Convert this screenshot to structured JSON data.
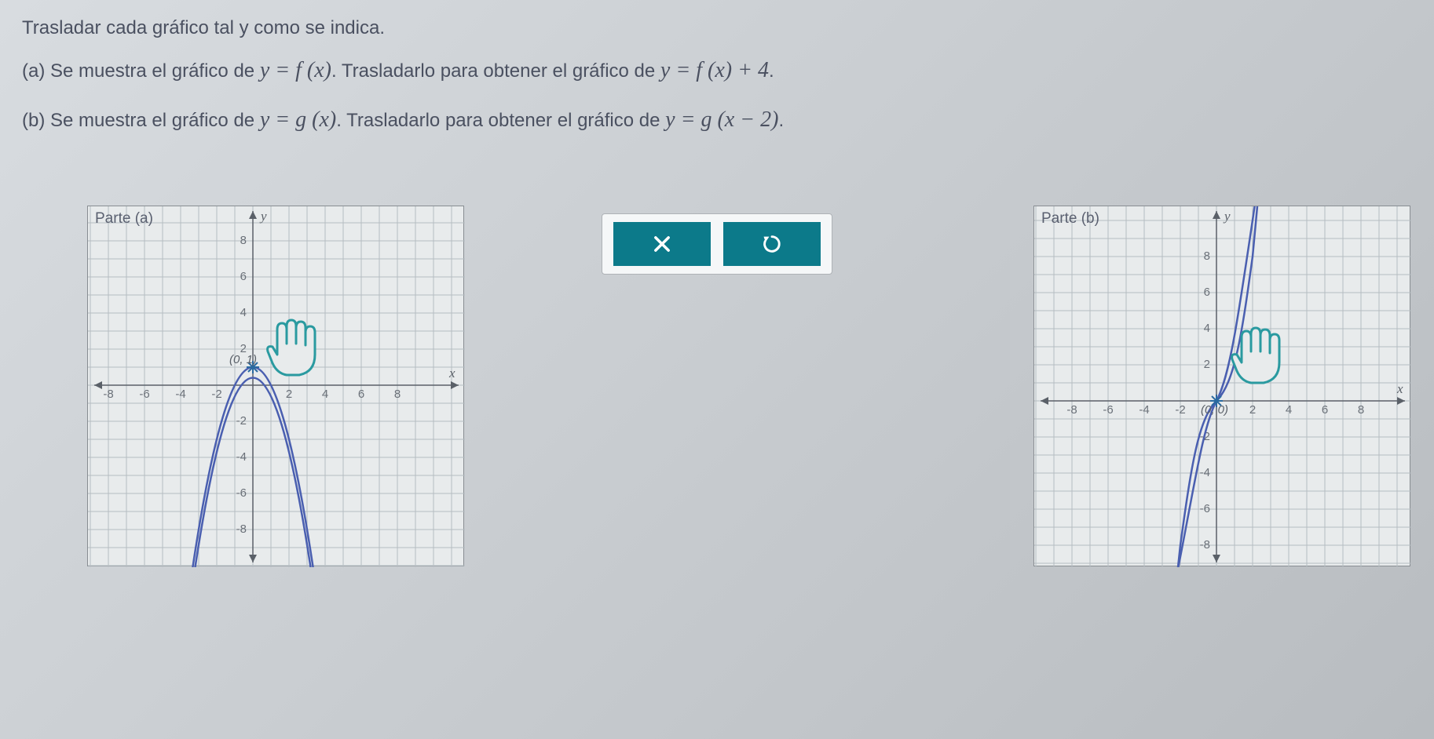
{
  "instruction": "Trasladar cada gráfico tal y como se indica.",
  "parts": {
    "a": {
      "prefix": "(a) Se muestra el gráfico de ",
      "eq1": "y = f (x)",
      "mid": ". Trasladarlo para obtener el gráfico de ",
      "eq2": "y = f (x) + 4",
      "suffix": "."
    },
    "b": {
      "prefix": "(b) Se muestra el gráfico de ",
      "eq1": "y = g (x)",
      "mid": ". Trasladarlo para obtener el gráfico de ",
      "eq2": "y = g (x − 2)",
      "suffix": "."
    }
  },
  "panelA": {
    "title": "Parte (a)",
    "xlabel": "x",
    "ylabel": "y",
    "point_label": "(0, 1)"
  },
  "panelB": {
    "title": "Parte (b)",
    "xlabel": "x",
    "ylabel": "y",
    "point_label": "(0, 0)"
  },
  "axis": {
    "ticks_x": [
      "-8",
      "-6",
      "-4",
      "-2",
      "2",
      "4",
      "6",
      "8"
    ],
    "ticks_y": [
      "8",
      "6",
      "4",
      "2",
      "-2",
      "-4",
      "-6",
      "-8"
    ]
  },
  "buttons": {
    "close": "close",
    "reset": "reset"
  },
  "chart_data": [
    {
      "type": "line",
      "title": "Parte (a)",
      "description": "Parabola f(x) = 1 - x^2 with vertex at (0,1)",
      "xlabel": "x",
      "ylabel": "y",
      "xlim": [
        -9,
        9
      ],
      "ylim": [
        -9,
        9
      ],
      "series": [
        {
          "name": "f(x)",
          "x": [
            -3,
            -2.5,
            -2,
            -1.5,
            -1,
            -0.5,
            0,
            0.5,
            1,
            1.5,
            2,
            2.5,
            3
          ],
          "y": [
            -8,
            -5.25,
            -3,
            -1.25,
            0,
            0.75,
            1,
            0.75,
            0,
            -1.25,
            -3,
            -5.25,
            -8
          ]
        }
      ],
      "vertex": {
        "x": 0,
        "y": 1
      },
      "grid": true
    },
    {
      "type": "line",
      "title": "Parte (b)",
      "description": "Cubic-like curve g(x) passes through origin (0,0)",
      "xlabel": "x",
      "ylabel": "y",
      "xlim": [
        -9,
        9
      ],
      "ylim": [
        -9,
        9
      ],
      "series": [
        {
          "name": "g(x)",
          "x": [
            -2,
            -1.5,
            -1,
            -0.5,
            0,
            0.5,
            1,
            1.5,
            2
          ],
          "y": [
            -8,
            -3.375,
            -1,
            -0.125,
            0,
            0.125,
            1,
            3.375,
            8
          ]
        }
      ],
      "point": {
        "x": 0,
        "y": 0
      },
      "grid": true
    }
  ]
}
